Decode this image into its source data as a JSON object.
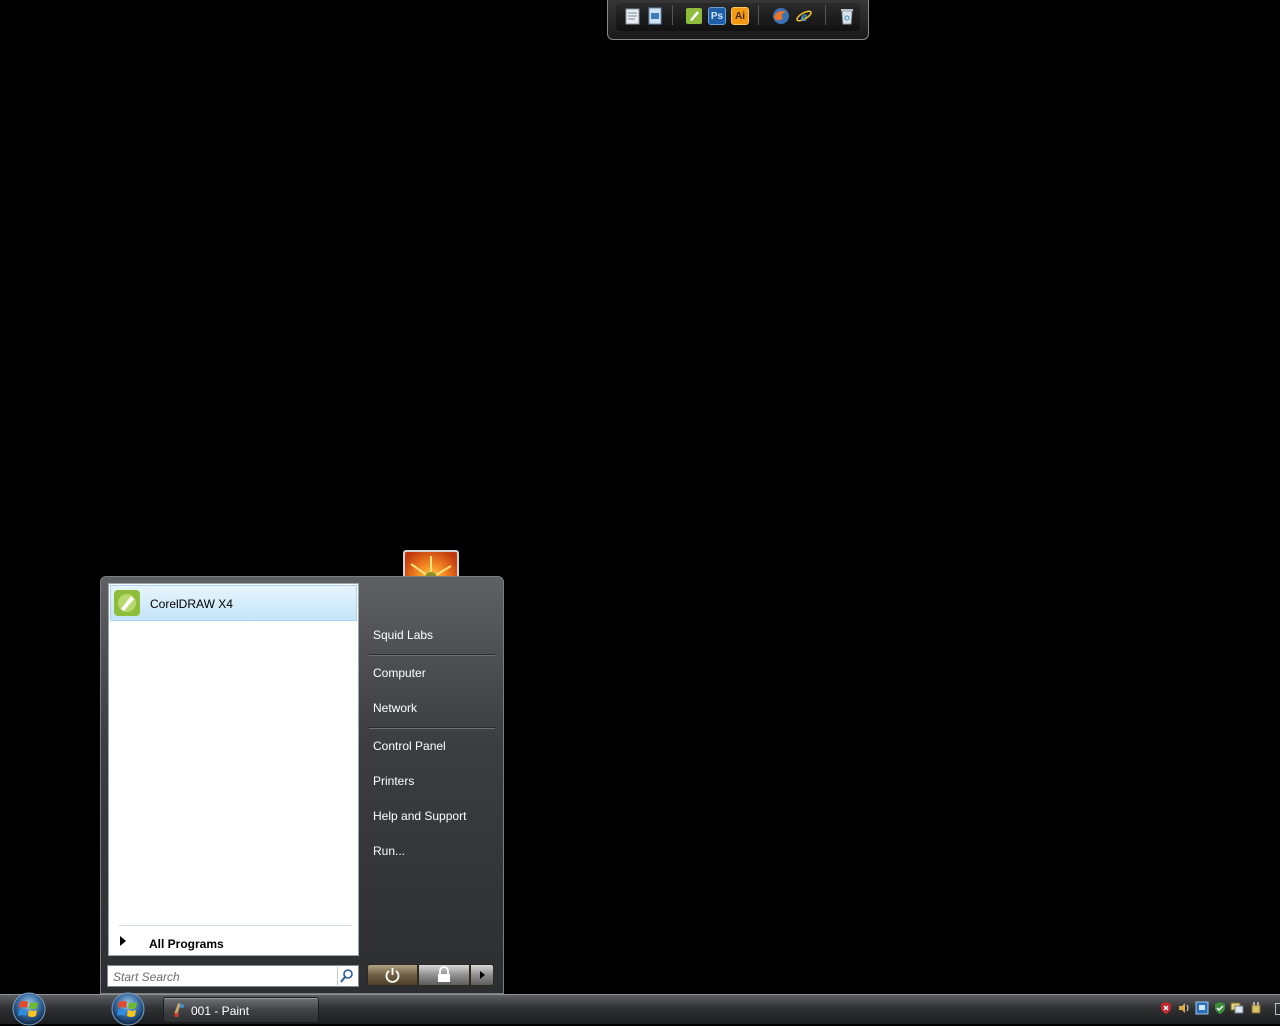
{
  "start_menu": {
    "pinned": [
      {
        "label": "CorelDRAW X4",
        "icon": "coreldraw-icon"
      }
    ],
    "all_programs_label": "All Programs",
    "search": {
      "placeholder": "Start Search",
      "value": ""
    },
    "right_items": [
      {
        "label": "Squid Labs"
      },
      {
        "label": "Computer"
      },
      {
        "label": "Network"
      },
      {
        "label": "Control Panel"
      },
      {
        "label": "Printers"
      },
      {
        "label": "Help and Support"
      },
      {
        "label": "Run..."
      }
    ],
    "power_buttons": [
      "power-icon",
      "lock-icon",
      "arrow-right-icon"
    ]
  },
  "dock": {
    "icons": [
      "notepad-icon",
      "file-icon",
      "coreldraw-icon",
      "photoshop-icon",
      "illustrator-icon",
      "firefox-icon",
      "internet-explorer-icon",
      "recycle-bin-icon"
    ],
    "photoshop_text": "Ps",
    "illustrator_text": "Ai"
  },
  "taskbar": {
    "window_button": {
      "label": "001 - Paint",
      "icon": "paint-icon"
    },
    "tray_icons": [
      "security-alert-icon",
      "volume-icon",
      "network-icon",
      "shield-check-icon",
      "display-icon",
      "power-plug-icon"
    ]
  },
  "colors": {
    "desktop": "#000000",
    "menu_highlight": "#c4e4f7",
    "photoshop": "#1f5ea8",
    "illustrator": "#f29a14"
  }
}
